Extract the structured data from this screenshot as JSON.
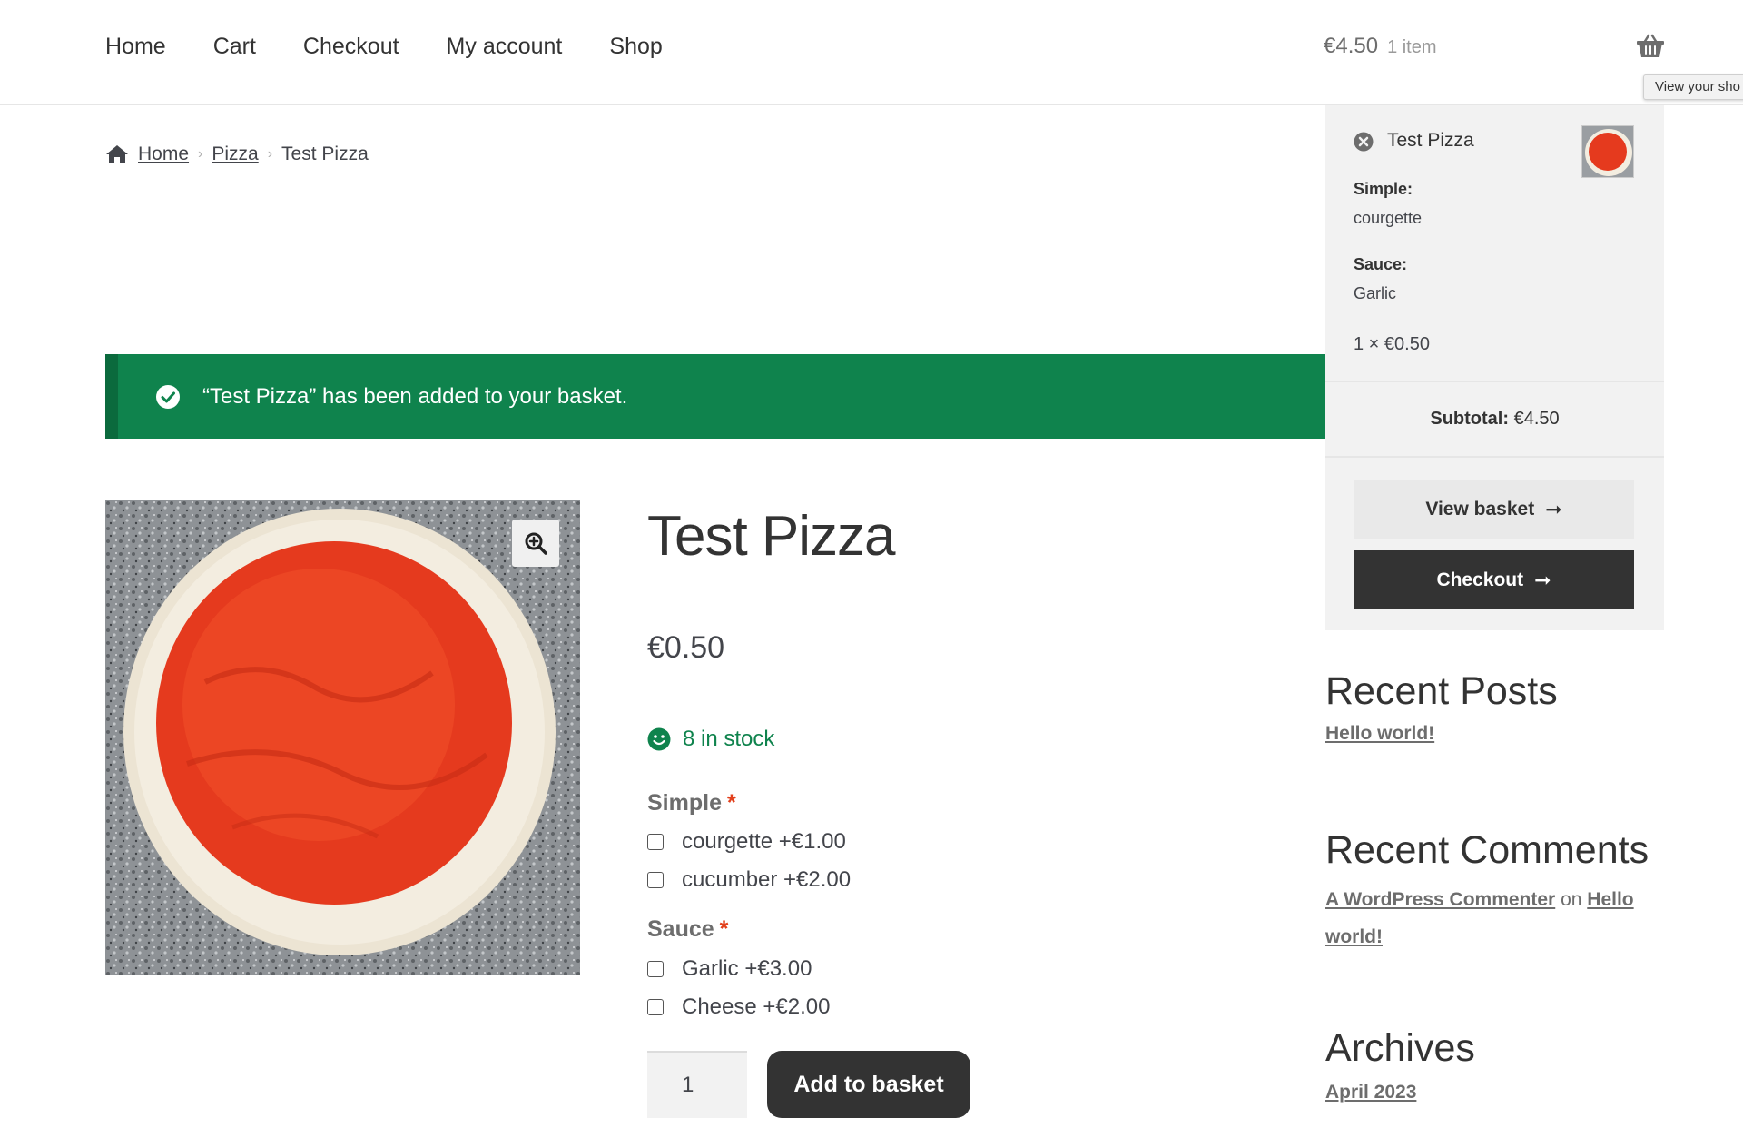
{
  "nav": {
    "items": [
      "Home",
      "Cart",
      "Checkout",
      "My account",
      "Shop"
    ]
  },
  "header_cart": {
    "total": "€4.50",
    "count": "1 item",
    "tooltip": "View your sho",
    "icon": "basket-icon"
  },
  "breadcrumb": {
    "home": "Home",
    "category": "Pizza",
    "current": "Test Pizza",
    "separator": "›"
  },
  "notice": {
    "message": "“Test Pizza” has been added to your basket.",
    "color": "#0f834d"
  },
  "product": {
    "title": "Test Pizza",
    "price": "€0.50",
    "stock": "8 in stock",
    "groups": [
      {
        "label": "Simple",
        "required_mark": "*",
        "options": [
          "courgette +€1.00",
          "cucumber +€2.00"
        ]
      },
      {
        "label": "Sauce",
        "required_mark": "*",
        "options": [
          "Garlic +€3.00",
          "Cheese +€2.00"
        ]
      }
    ],
    "quantity": "1",
    "add_button": "Add to basket"
  },
  "minicart": {
    "item_name": "Test Pizza",
    "meta": [
      {
        "label": "Simple:",
        "value": "courgette"
      },
      {
        "label": "Sauce:",
        "value": "Garlic"
      }
    ],
    "qty_line": "1 × €0.50",
    "subtotal_label": "Subtotal:",
    "subtotal_value": "€4.50",
    "view_basket": "View basket",
    "checkout": "Checkout",
    "arrow": "➞"
  },
  "widgets": {
    "recent_posts_title": "Recent Posts",
    "recent_post": "Hello world!",
    "recent_comments_title": "Recent Comments",
    "commenter": "A WordPress Commenter",
    "on_word": "on",
    "comment_post": "Hello world!",
    "archives_title": "Archives",
    "archive_item": "April 2023"
  },
  "colors": {
    "accent_green": "#0f834d",
    "required_red": "#e2401c",
    "dark_button": "#333333"
  }
}
